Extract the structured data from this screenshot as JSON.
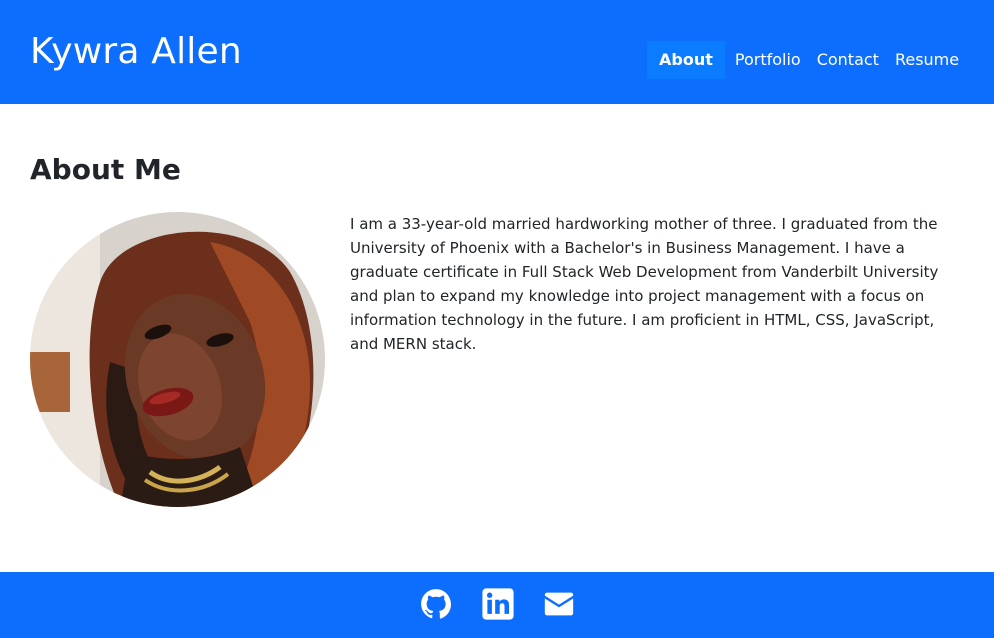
{
  "header": {
    "brand": "Kywra Allen",
    "nav": [
      {
        "label": "About",
        "active": true
      },
      {
        "label": "Portfolio",
        "active": false
      },
      {
        "label": "Contact",
        "active": false
      },
      {
        "label": "Resume",
        "active": false
      }
    ]
  },
  "about": {
    "title": "About Me",
    "bio": "I am a 33-year-old married hardworking mother of three. I graduated from the University of Phoenix with a Bachelor's in Business Management. I have a graduate certificate in Full Stack Web Development from Vanderbilt University and plan to expand my knowledge into project management with a focus on information technology in the future. I am proficient in HTML, CSS, JavaScript, and MERN stack.",
    "photo_icon": "profile-photo"
  },
  "footer": {
    "links": [
      {
        "icon": "github-icon"
      },
      {
        "icon": "linkedin-icon"
      },
      {
        "icon": "mail-icon"
      }
    ]
  },
  "colors": {
    "primary": "#0d6efd",
    "active_nav": "#0b7cff",
    "text": "#212529",
    "background": "#ffffff"
  }
}
